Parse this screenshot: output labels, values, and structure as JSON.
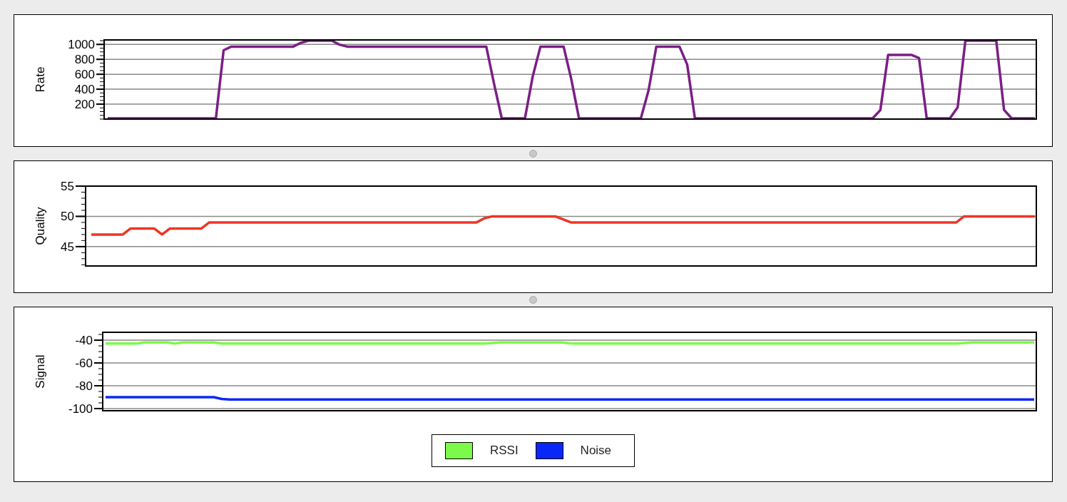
{
  "panels": [
    {
      "chart_data": {
        "type": "line",
        "grid": true,
        "ylabel": "Rate",
        "ylim": [
          0,
          1060
        ],
        "yticks": [
          200,
          400,
          600,
          800,
          1000
        ],
        "series": [
          {
            "color": "#7b1f86",
            "values": [
              10,
              10,
              10,
              10,
              10,
              10,
              10,
              10,
              10,
              10,
              10,
              10,
              10,
              10,
              10,
              922,
              970,
              970,
              970,
              970,
              970,
              970,
              970,
              970,
              970,
              1022,
              1050,
              1050,
              1050,
              1050,
              997,
              970,
              970,
              970,
              970,
              970,
              970,
              970,
              970,
              970,
              970,
              970,
              970,
              970,
              970,
              970,
              970,
              970,
              970,
              970,
              473,
              10,
              10,
              10,
              10,
              567,
              970,
              970,
              970,
              970,
              534,
              10,
              10,
              10,
              10,
              10,
              10,
              10,
              10,
              10,
              385,
              970,
              970,
              970,
              970,
              730,
              10,
              10,
              10,
              10,
              10,
              10,
              10,
              10,
              10,
              10,
              10,
              10,
              10,
              10,
              10,
              10,
              10,
              10,
              10,
              10,
              10,
              10,
              10,
              10,
              120,
              860,
              860,
              860,
              860,
              817,
              10,
              10,
              10,
              10,
              157,
              1050,
              1050,
              1050,
              1050,
              1050,
              123,
              10,
              10,
              10,
              10
            ]
          }
        ]
      }
    },
    {
      "chart_data": {
        "type": "line",
        "grid": true,
        "ylabel": "Quality",
        "ylim": [
          41.8,
          55
        ],
        "yticks": [
          45,
          50,
          55
        ],
        "series": [
          {
            "color": "#ee3524",
            "values": [
              47,
              47,
              47,
              47,
              47,
              48,
              48,
              48,
              48,
              47,
              48,
              48,
              48,
              48,
              48,
              49,
              49,
              49,
              49,
              49,
              49,
              49,
              49,
              49,
              49,
              49,
              49,
              49,
              49,
              49,
              49,
              49,
              49,
              49,
              49,
              49,
              49,
              49,
              49,
              49,
              49,
              49,
              49,
              49,
              49,
              49,
              49,
              49,
              49,
              49,
              49.7,
              50,
              50,
              50,
              50,
              50,
              50,
              50,
              50,
              50,
              49.5,
              49,
              49,
              49,
              49,
              49,
              49,
              49,
              49,
              49,
              49,
              49,
              49,
              49,
              49,
              49,
              49,
              49,
              49,
              49,
              49,
              49,
              49,
              49,
              49,
              49,
              49,
              49,
              49,
              49,
              49,
              49,
              49,
              49,
              49,
              49,
              49,
              49,
              49,
              49,
              49,
              49,
              49,
              49,
              49,
              49,
              49,
              49,
              49,
              49,
              49,
              50,
              50,
              50,
              50,
              50,
              50,
              50,
              50,
              50,
              50
            ]
          }
        ]
      }
    },
    {
      "chart_data": {
        "type": "line",
        "grid": true,
        "ylabel": "Signal",
        "ylim": [
          -101.9,
          -33.1
        ],
        "yticks": [
          -100,
          -80,
          -60,
          -40
        ],
        "series": [
          {
            "name": "RSSI",
            "color": "#7cf94a",
            "values": [
              -43,
              -43,
              -43,
              -43,
              -43,
              -42,
              -42,
              -42,
              -42,
              -43,
              -42,
              -42,
              -42,
              -42,
              -42,
              -43,
              -43,
              -43,
              -43,
              -43,
              -43,
              -43,
              -43,
              -43,
              -43,
              -43,
              -43,
              -43,
              -43,
              -43,
              -43,
              -43,
              -43,
              -43,
              -43,
              -43,
              -43,
              -43,
              -43,
              -43,
              -43,
              -43,
              -43,
              -43,
              -43,
              -43,
              -43,
              -43,
              -43,
              -43,
              -42.4,
              -42,
              -42,
              -42,
              -42,
              -42,
              -42,
              -42,
              -42,
              -42,
              -42.8,
              -43,
              -43,
              -43,
              -43,
              -43,
              -43,
              -43,
              -43,
              -43,
              -43,
              -43,
              -43,
              -43,
              -43,
              -43,
              -43,
              -43,
              -43,
              -43,
              -43,
              -43,
              -43,
              -43,
              -43,
              -43,
              -43,
              -43,
              -43,
              -43,
              -43,
              -43,
              -43,
              -43,
              -43,
              -43,
              -43,
              -43,
              -43,
              -43,
              -43,
              -43,
              -43,
              -43,
              -43,
              -43,
              -43,
              -43,
              -43,
              -43,
              -43,
              -42.4,
              -42,
              -42,
              -42,
              -42,
              -42,
              -42,
              -42,
              -42,
              -42
            ]
          },
          {
            "name": "Noise",
            "color": "#0a28f5",
            "values": [
              -90,
              -90,
              -90,
              -90,
              -90,
              -90,
              -90,
              -90,
              -90,
              -90,
              -90,
              -90,
              -90,
              -90,
              -90,
              -91.6,
              -92,
              -92,
              -92,
              -92,
              -92,
              -92,
              -92,
              -92,
              -92,
              -92,
              -92,
              -92,
              -92,
              -92,
              -92,
              -92,
              -92,
              -92,
              -92,
              -92,
              -92,
              -92,
              -92,
              -92,
              -92,
              -92,
              -92,
              -92,
              -92,
              -92,
              -92,
              -92,
              -92,
              -92,
              -92,
              -92,
              -92,
              -92,
              -92,
              -92,
              -92,
              -92,
              -92,
              -92,
              -92,
              -92,
              -92,
              -92,
              -92,
              -92,
              -92,
              -92,
              -92,
              -92,
              -92,
              -92,
              -92,
              -92,
              -92,
              -92,
              -92,
              -92,
              -92,
              -92,
              -92,
              -92,
              -92,
              -92,
              -92,
              -92,
              -92,
              -92,
              -92,
              -92,
              -92,
              -92,
              -92,
              -92,
              -92,
              -92,
              -92,
              -92,
              -92,
              -92,
              -92,
              -92,
              -92,
              -92,
              -92,
              -92,
              -92,
              -92,
              -92,
              -92,
              -92,
              -92,
              -92,
              -92,
              -92,
              -92,
              -92,
              -92,
              -92,
              -92,
              -92
            ]
          }
        ]
      }
    }
  ]
}
